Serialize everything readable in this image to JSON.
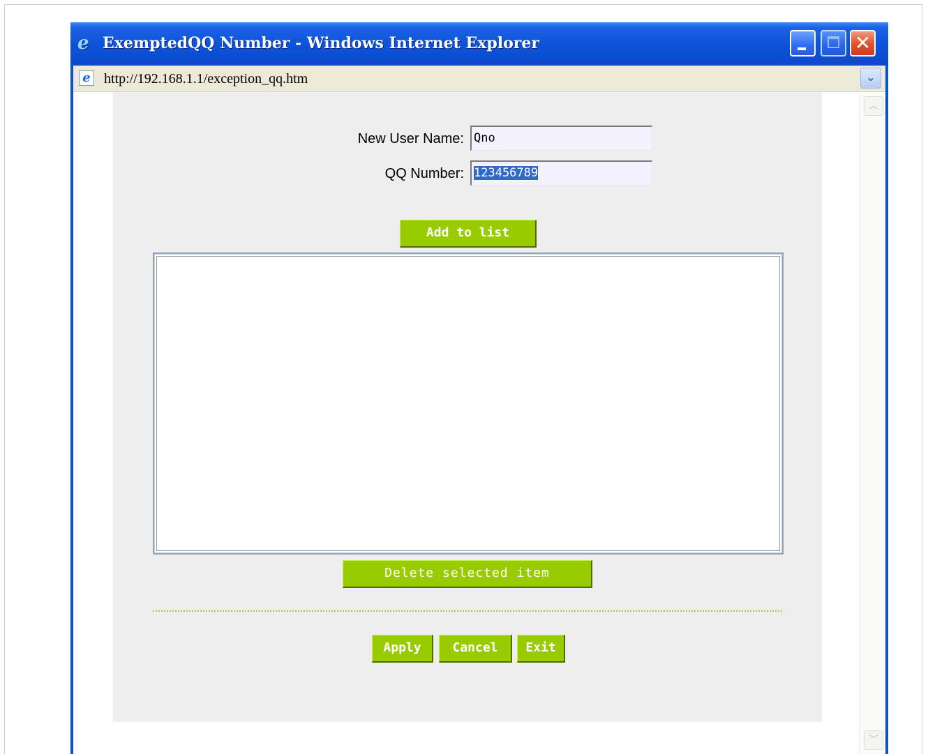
{
  "window": {
    "title": "ExemptedQQ Number - Windows Internet Explorer",
    "close_glyph": "✕"
  },
  "address_bar": {
    "url": "http://192.168.1.1/exception_qq.htm",
    "icon_glyph": "e",
    "dropdown_glyph": "⌄"
  },
  "form": {
    "username_label": "New User Name:",
    "username_value": "Qno",
    "qq_label": "QQ Number:",
    "qq_value": "123456789"
  },
  "buttons": {
    "add": "Add to list",
    "delete": "Delete selected item",
    "apply": "Apply",
    "cancel": "Cancel",
    "exit": "Exit"
  },
  "list": {
    "items": []
  },
  "scrollbar": {
    "up_glyph": "︿",
    "down_glyph": "﹀"
  },
  "colors": {
    "accent_green": "#99cc00",
    "titlebar_blue": "#0b52d9",
    "panel_gray": "#eeeeee",
    "selection_blue": "#316ac5"
  }
}
